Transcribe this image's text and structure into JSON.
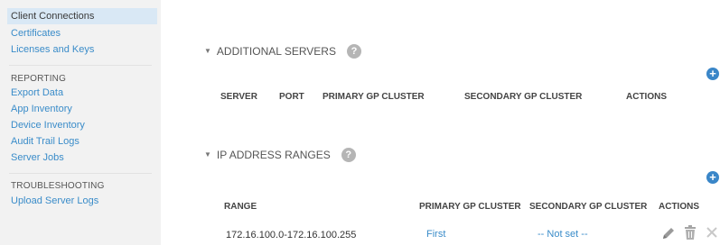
{
  "sidebar": {
    "selected": "Client Connections",
    "top_items": [
      "Certificates",
      "Licenses and Keys"
    ],
    "reporting": {
      "heading": "REPORTING",
      "items": [
        "Export Data",
        "App Inventory",
        "Device Inventory",
        "Audit Trail Logs",
        "Server Jobs"
      ]
    },
    "troubleshooting": {
      "heading": "TROUBLESHOOTING",
      "items": [
        "Upload Server Logs"
      ]
    }
  },
  "additional_servers": {
    "title": "ADDITIONAL SERVERS",
    "help": "?",
    "columns": [
      "SERVER",
      "PORT",
      "PRIMARY GP CLUSTER",
      "SECONDARY GP CLUSTER",
      "ACTIONS"
    ]
  },
  "ip_ranges": {
    "title": "IP ADDRESS RANGES",
    "help": "?",
    "columns": [
      "RANGE",
      "PRIMARY GP CLUSTER",
      "SECONDARY GP CLUSTER",
      "ACTIONS"
    ],
    "rows": [
      {
        "range": "172.16.100.0-172.16.100.255",
        "primary": "First",
        "secondary": "-- Not set --"
      }
    ]
  },
  "icons": {
    "add": "plus-circle-icon",
    "edit": "pencil-icon",
    "delete": "trash-icon",
    "close": "x-icon"
  },
  "colors": {
    "link": "#3a8cc9",
    "selected_bg": "#d9e8f5",
    "add_button": "#3a86c8"
  }
}
